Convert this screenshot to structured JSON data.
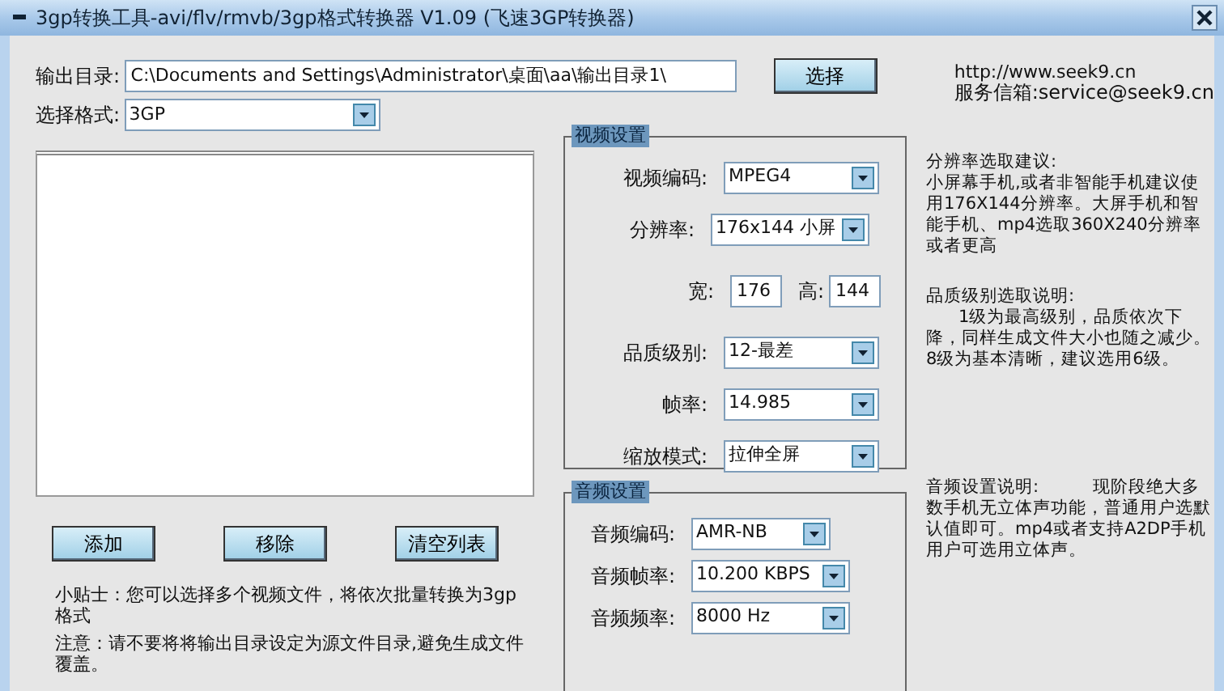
{
  "window": {
    "title": "3gp转换工具-avi/flv/rmvb/3gp格式转换器 V1.09 (飞速3GP转换器)"
  },
  "output": {
    "label": "输出目录:",
    "value": "C:\\Documents and Settings\\Administrator\\桌面\\aa\\输出目录1\\",
    "button": "选择"
  },
  "links": [
    "http://www.seek9.cn",
    "服务信箱:service@seek9.cn"
  ],
  "format": {
    "label": "选择格式:",
    "value": "3GP"
  },
  "list_buttons": [
    "添加",
    "移除",
    "清空列表"
  ],
  "tips": [
    "小贴士：您可以选择多个视频文件，将依次批量转换为3gp格式",
    "注意：请不要将将输出目录设定为源文件目录,避免生成文件覆盖。"
  ],
  "video_settings": {
    "title": "视频设置",
    "fields": [
      {
        "kind": "select",
        "label": "视频编码:",
        "value": "MPEG4"
      },
      {
        "kind": "select",
        "label": "分辨率:",
        "value": "176x144  小屏"
      },
      {
        "kind": "size",
        "label": "宽:",
        "value": "176",
        "label2": "高:",
        "value2": "144"
      },
      {
        "kind": "select",
        "label": "品质级别:",
        "value": "12-最差"
      },
      {
        "kind": "select",
        "label": "帧率:",
        "value": "14.985"
      },
      {
        "kind": "select",
        "label": "缩放模式:",
        "value": "拉伸全屏"
      }
    ]
  },
  "audio_settings": {
    "title": "音频设置",
    "fields": [
      {
        "kind": "select",
        "label": "音频编码:",
        "value": "AMR-NB"
      },
      {
        "kind": "select",
        "label": "音频帧率:",
        "value": "10.200 KBPS"
      },
      {
        "kind": "select",
        "label": "音频频率:",
        "value": "8000 Hz"
      }
    ]
  },
  "notes": [
    "分辨率选取建议:\n小屏幕手机,或者非智能手机建议使用176X144分辨率。大屏手机和智能手机、mp4选取360X240分辨率或者更高",
    "品质级别选取说明:\n      1级为最高级别，品质依次下降，同样生成文件大小也随之减少。8级为基本清晰，建议选用6级。",
    "音频设置说明:          现阶段绝大多数手机无立体声功能，普通用户选默认值即可。mp4或者支持A2DP手机用户可选用立体声。"
  ]
}
